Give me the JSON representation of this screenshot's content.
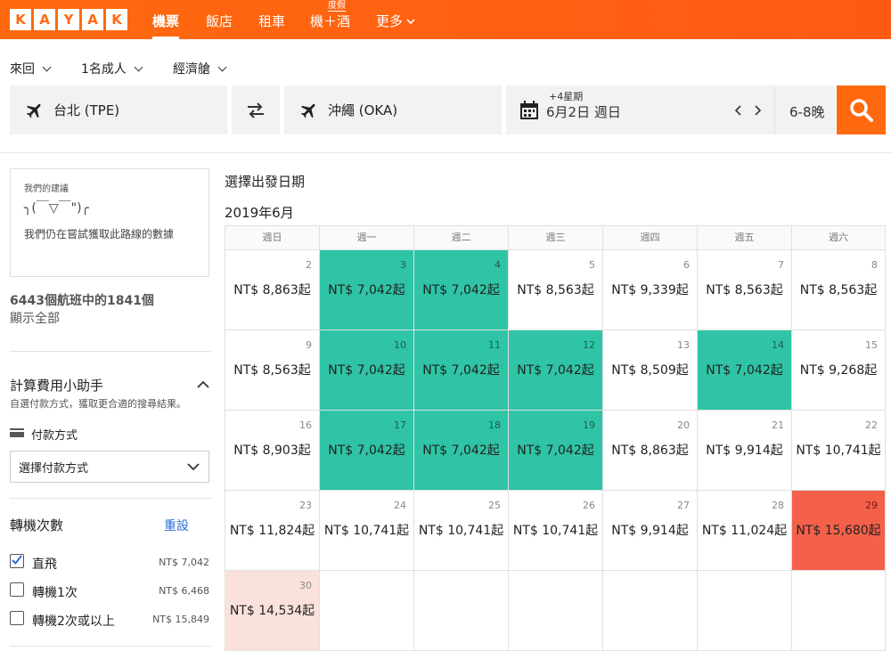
{
  "nav": {
    "logo_letters": [
      "K",
      "A",
      "Y",
      "A",
      "K"
    ],
    "items": [
      {
        "label": "機票"
      },
      {
        "label": "飯店"
      },
      {
        "label": "租車"
      },
      {
        "label": "機＋酒"
      },
      {
        "label": "更多"
      }
    ],
    "badge": "度假"
  },
  "search": {
    "trip_type": "來回",
    "travelers": "1名成人",
    "cabin": "經濟艙",
    "origin": "台北 (TPE)",
    "destination": "沖繩 (OKA)",
    "date_offset": "+4星期",
    "date": "6月2日 週日",
    "nights": "6-8晚"
  },
  "sidebar": {
    "advice_title": "我們的建議",
    "advice_emoticon": "╮(￣▽￣\")╭",
    "advice_text": "我們仍在嘗試獲取此路線的數據",
    "result_count": "6443個航班中的1841個",
    "show_all": "顯示全部",
    "fee_title": "計算費用小助手",
    "fee_sub": "自選付款方式，獲取更合適的搜尋結果。",
    "payment_label": "付款方式",
    "payment_select": "選擇付款方式",
    "stops_title": "轉機次數",
    "reset": "重設",
    "stops": [
      {
        "label": "直飛",
        "price": "NT$ 7,042",
        "checked": true
      },
      {
        "label": "轉機1次",
        "price": "NT$ 6,468",
        "checked": false
      },
      {
        "label": "轉機2次或以上",
        "price": "NT$ 15,849",
        "checked": false
      }
    ]
  },
  "calendar": {
    "title": "選擇出發日期",
    "month": "2019年6月",
    "weekdays": [
      "週日",
      "週一",
      "週二",
      "週三",
      "週四",
      "週五",
      "週六"
    ],
    "cells": [
      {
        "day": "2",
        "price": "NT$ 8,863起",
        "type": "normal"
      },
      {
        "day": "3",
        "price": "NT$ 7,042起",
        "type": "cheap"
      },
      {
        "day": "4",
        "price": "NT$ 7,042起",
        "type": "cheap"
      },
      {
        "day": "5",
        "price": "NT$ 8,563起",
        "type": "normal"
      },
      {
        "day": "6",
        "price": "NT$ 9,339起",
        "type": "normal"
      },
      {
        "day": "7",
        "price": "NT$ 8,563起",
        "type": "normal"
      },
      {
        "day": "8",
        "price": "NT$ 8,563起",
        "type": "normal"
      },
      {
        "day": "9",
        "price": "NT$ 8,563起",
        "type": "normal"
      },
      {
        "day": "10",
        "price": "NT$ 7,042起",
        "type": "cheap"
      },
      {
        "day": "11",
        "price": "NT$ 7,042起",
        "type": "cheap"
      },
      {
        "day": "12",
        "price": "NT$ 7,042起",
        "type": "cheap"
      },
      {
        "day": "13",
        "price": "NT$ 8,509起",
        "type": "normal"
      },
      {
        "day": "14",
        "price": "NT$ 7,042起",
        "type": "cheap"
      },
      {
        "day": "15",
        "price": "NT$ 9,268起",
        "type": "normal"
      },
      {
        "day": "16",
        "price": "NT$ 8,903起",
        "type": "normal"
      },
      {
        "day": "17",
        "price": "NT$ 7,042起",
        "type": "cheap"
      },
      {
        "day": "18",
        "price": "NT$ 7,042起",
        "type": "cheap"
      },
      {
        "day": "19",
        "price": "NT$ 7,042起",
        "type": "cheap"
      },
      {
        "day": "20",
        "price": "NT$ 8,863起",
        "type": "normal"
      },
      {
        "day": "21",
        "price": "NT$ 9,914起",
        "type": "normal"
      },
      {
        "day": "22",
        "price": "NT$ 10,741起",
        "type": "normal"
      },
      {
        "day": "23",
        "price": "NT$ 11,824起",
        "type": "normal"
      },
      {
        "day": "24",
        "price": "NT$ 10,741起",
        "type": "normal"
      },
      {
        "day": "25",
        "price": "NT$ 10,741起",
        "type": "normal"
      },
      {
        "day": "26",
        "price": "NT$ 10,741起",
        "type": "normal"
      },
      {
        "day": "27",
        "price": "NT$ 9,914起",
        "type": "normal"
      },
      {
        "day": "28",
        "price": "NT$ 11,024起",
        "type": "normal"
      },
      {
        "day": "29",
        "price": "NT$ 15,680起",
        "type": "high"
      },
      {
        "day": "30",
        "price": "NT$ 14,534起",
        "type": "pink"
      },
      {
        "day": "",
        "price": "",
        "type": "empty"
      },
      {
        "day": "",
        "price": "",
        "type": "empty"
      },
      {
        "day": "",
        "price": "",
        "type": "empty"
      },
      {
        "day": "",
        "price": "",
        "type": "empty"
      },
      {
        "day": "",
        "price": "",
        "type": "empty"
      },
      {
        "day": "",
        "price": "",
        "type": "empty"
      }
    ]
  },
  "colors": {
    "brand": "#ff690f",
    "cheap": "#2ec4a5",
    "high": "#f4604a",
    "pink": "#fbe1dc"
  }
}
